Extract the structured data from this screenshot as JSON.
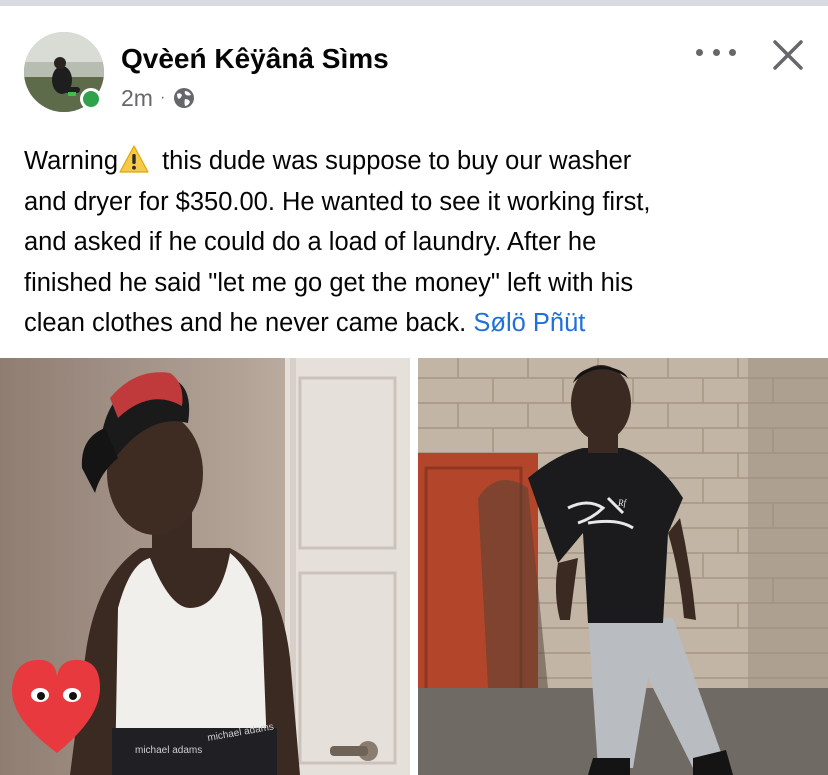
{
  "post": {
    "author_name": "Qvèeń Kêÿânâ Sìms",
    "timestamp": "2m",
    "separator": "·",
    "privacy_icon": "globe-icon",
    "text_lines": [
      {
        "before": "Warning",
        "emoji": "warning-sign",
        "after": " this dude was suppose to buy our washer"
      },
      {
        "text": "and dryer for $350.00. He wanted to see it working first,"
      },
      {
        "text": "and asked if he could do a load of laundry. After he"
      },
      {
        "text": "finished he said \"let me go get the money\" left with his"
      },
      {
        "text": "clean clothes and he never came back. ",
        "mention": "Sølö Pñüt"
      }
    ],
    "photos": [
      {
        "name": "photo-man-white-tank-top",
        "caption_text": "michael adams"
      },
      {
        "name": "photo-man-black-tshirt",
        "shirt_text": "Rf"
      }
    ]
  },
  "ui": {
    "online_status_color": "#31a24c",
    "link_color": "#216fdb",
    "secondary_text_color": "#65676b"
  }
}
